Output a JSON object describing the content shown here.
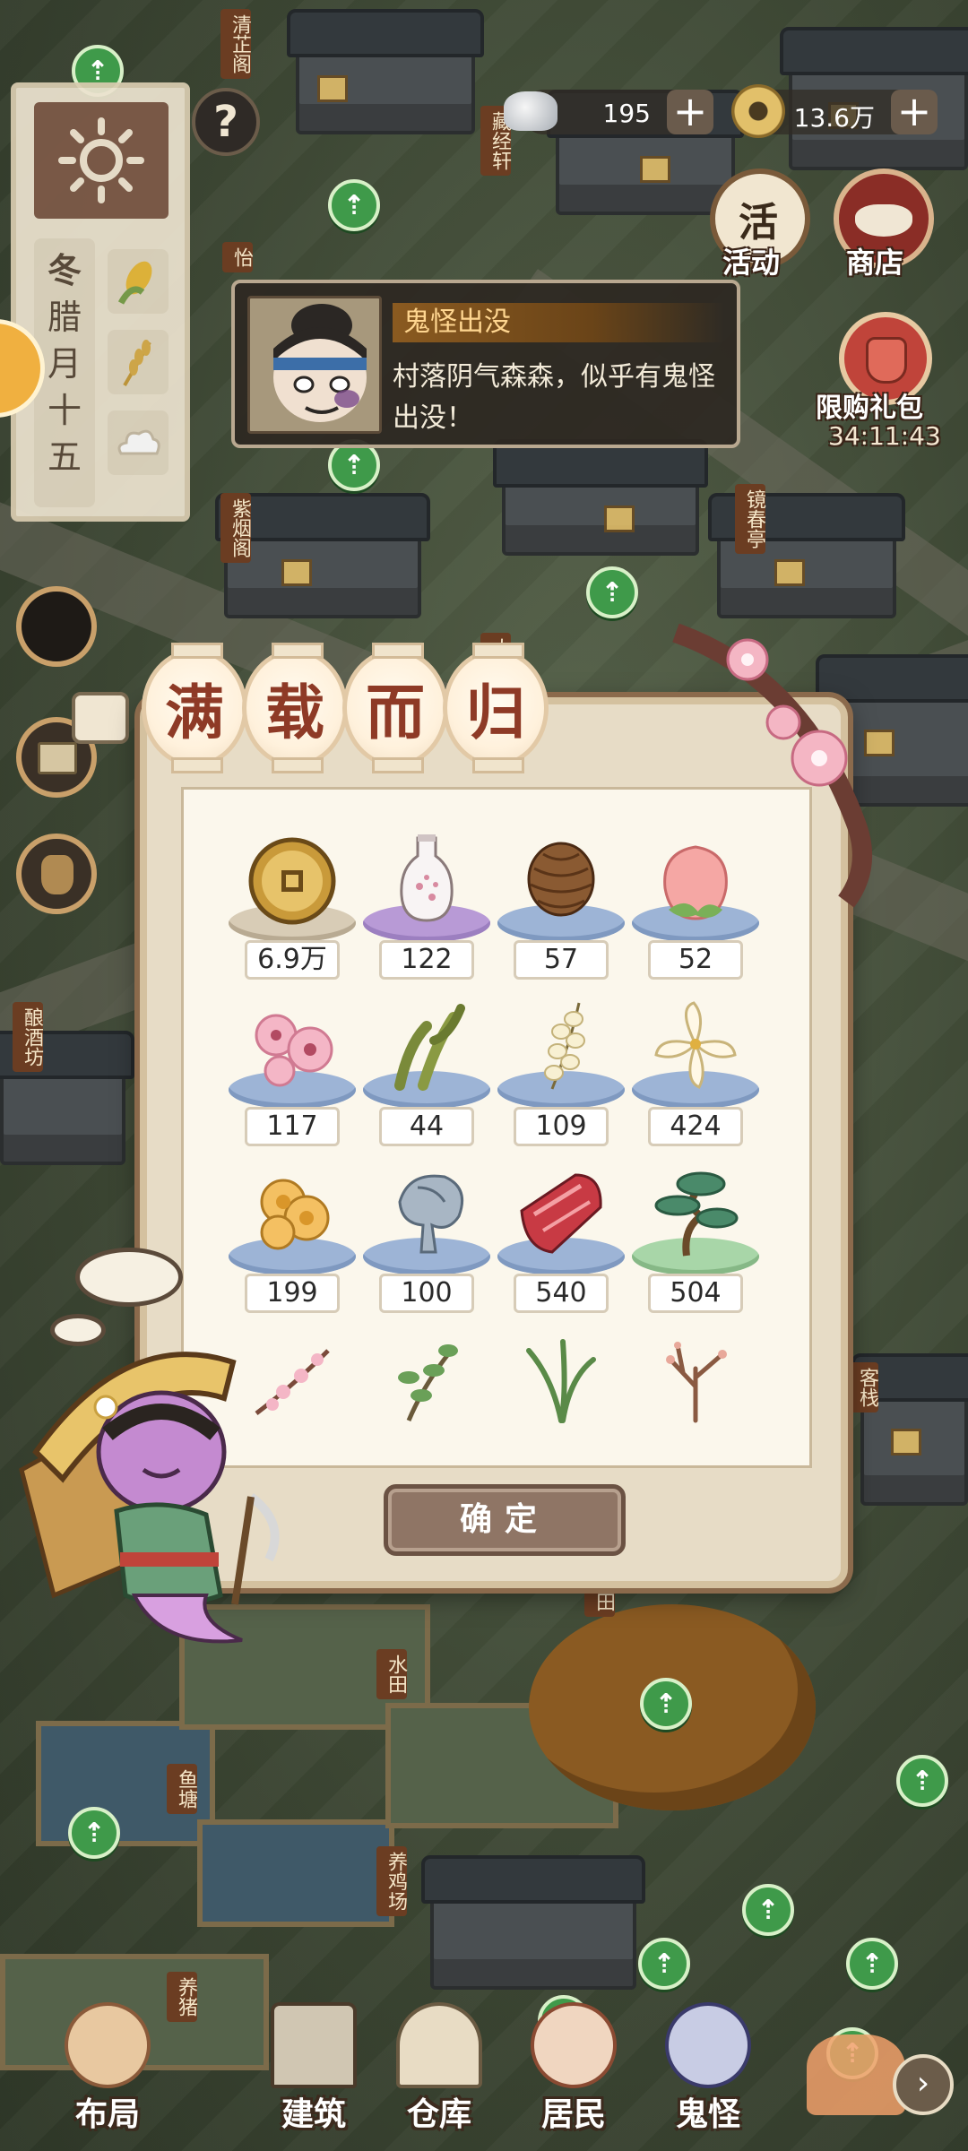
{
  "map": {
    "signs": [
      "清芷阁",
      "藏经轩",
      "怡",
      "紫烟阁",
      "镜春亭",
      "酿酒坊",
      "水田",
      "鱼塘",
      "养鸡场",
      "养猪",
      "大",
      "月",
      "田",
      "客栈"
    ],
    "marker_symbol": "⇡"
  },
  "season_panel": {
    "season": "冬",
    "date_lines": [
      "腊",
      "月",
      "十",
      "五"
    ],
    "help_label": "?"
  },
  "currency": {
    "silver": "195",
    "coins": "13.6万",
    "plus": "+"
  },
  "side_buttons": {
    "activity": "活动",
    "activity_glyph": "活",
    "shop": "商店",
    "limited_gift": "限购礼包",
    "limited_timer": "34:11:43"
  },
  "notification": {
    "title": "鬼怪出没",
    "body": "村落阴气森森，似乎有鬼怪出没！"
  },
  "dialog": {
    "title_chars": [
      "满",
      "载",
      "而",
      "归"
    ],
    "items": [
      {
        "name": "coin-icon",
        "qty": "6.9万",
        "plate": "gold"
      },
      {
        "name": "wine-bottle-icon",
        "qty": "122",
        "plate": "purple"
      },
      {
        "name": "pinecone-icon",
        "qty": "57",
        "plate": "blue"
      },
      {
        "name": "peach-icon",
        "qty": "52",
        "plate": "blue"
      },
      {
        "name": "peach-blossom-icon",
        "qty": "117",
        "plate": "blue"
      },
      {
        "name": "bean-pods-icon",
        "qty": "44",
        "plate": "blue"
      },
      {
        "name": "locust-flower-icon",
        "qty": "109",
        "plate": "blue"
      },
      {
        "name": "orchid-icon",
        "qty": "424",
        "plate": "blue"
      },
      {
        "name": "marigold-icon",
        "qty": "199",
        "plate": "blue"
      },
      {
        "name": "shrimp-icon",
        "qty": "100",
        "plate": "blue"
      },
      {
        "name": "raw-meat-icon",
        "qty": "540",
        "plate": "blue"
      },
      {
        "name": "bonsai-pine-icon",
        "qty": "504",
        "plate": "green"
      },
      {
        "name": "blossom-branch-icon",
        "qty": "",
        "plate": "none"
      },
      {
        "name": "leafy-sprig-icon",
        "qty": "",
        "plate": "none"
      },
      {
        "name": "grass-blades-icon",
        "qty": "",
        "plate": "none"
      },
      {
        "name": "bare-branch-icon",
        "qty": "",
        "plate": "none"
      }
    ],
    "confirm_label": "确定"
  },
  "bottom_nav": [
    {
      "label": "布局",
      "icon": "layout-icon"
    },
    {
      "label": "建筑",
      "icon": "building-icon"
    },
    {
      "label": "仓库",
      "icon": "warehouse-icon"
    },
    {
      "label": "居民",
      "icon": "resident-icon"
    },
    {
      "label": "鬼怪",
      "icon": "ghost-icon"
    }
  ],
  "colors": {
    "accent_red": "#8e3a26",
    "dialog_bg": "#e7dcc6",
    "marker_green": "#3f9a4a"
  }
}
